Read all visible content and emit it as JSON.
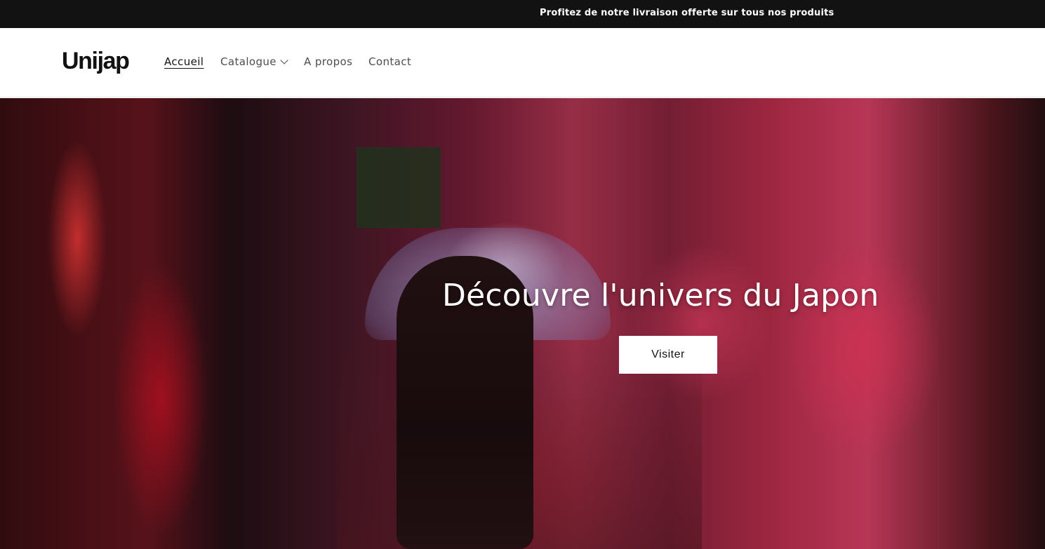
{
  "announcement": {
    "text": "Profitez de notre livraison offerte sur tous nos produits"
  },
  "header": {
    "logo": "Unijap",
    "nav": [
      {
        "label": "Accueil",
        "active": true
      },
      {
        "label": "Catalogue",
        "has_dropdown": true
      },
      {
        "label": "A propos"
      },
      {
        "label": "Contact"
      }
    ],
    "dropdown_icon": "chevron-down-icon"
  },
  "hero": {
    "title": "Découvre l'univers du Japon",
    "button_label": "Visiter"
  },
  "colors": {
    "announcement_bg": "#121212",
    "header_bg": "#ffffff",
    "text_primary": "#121212",
    "nav_text": "#4d4d4d",
    "hero_button_bg": "#ffffff"
  }
}
